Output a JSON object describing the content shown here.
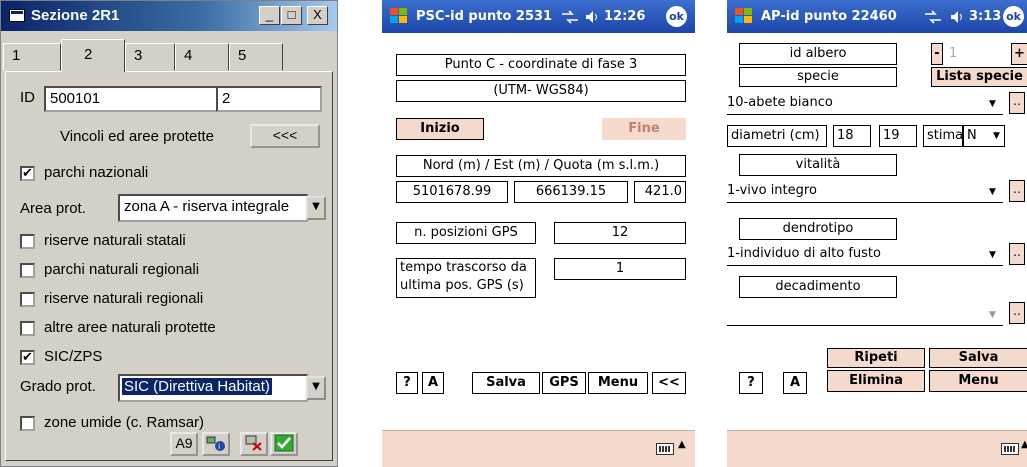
{
  "panel1": {
    "title": "Sezione 2R1",
    "window_buttons": [
      "_",
      "□",
      "X"
    ],
    "tabs": [
      "1",
      "2",
      "3",
      "4",
      "5"
    ],
    "active_tab": "2",
    "id_label": "ID",
    "id_value": "500101",
    "id_value2": "2",
    "vincoli_label": "Vincoli ed aree protette",
    "vincoli_button": "<<<",
    "parchi_nazionali": {
      "label": "parchi nazionali",
      "checked": true
    },
    "area_prot_label": "Area prot.",
    "area_prot_value": "zona A - riserva integrale",
    "checkboxes": [
      {
        "label": "riserve naturali statali",
        "checked": false
      },
      {
        "label": "parchi naturali regionali",
        "checked": false
      },
      {
        "label": "riserve naturali regionali",
        "checked": false
      },
      {
        "label": "altre aree naturali protette",
        "checked": false
      },
      {
        "label": "SIC/ZPS",
        "checked": true
      }
    ],
    "grado_label": "Grado prot.",
    "grado_value": "SIC (Direttiva Habitat)",
    "zone_umide": {
      "label": "zone umide (c. Ramsar)",
      "checked": false
    },
    "bottom_buttons": [
      "A9",
      "gps-info-icon",
      "gps-delete-icon",
      "confirm-check-icon"
    ]
  },
  "panel2": {
    "title": "PSC-id punto 2531",
    "status": "12:26",
    "ok": "ok",
    "heading1": "Punto C - coordinate di fase 3",
    "heading2": "(UTM- WGS84)",
    "inizio": "Inizio",
    "fine": "Fine",
    "coord_header": "Nord (m) / Est (m) / Quota (m s.l.m.)",
    "nord": "5101678.99",
    "est": "666139.15",
    "quota": "421.0",
    "posizioni_label": "n. posizioni GPS",
    "posizioni_value": "12",
    "tempo_label": "tempo trascorso da ultima pos. GPS (s)",
    "tempo_value": "1",
    "buttons": [
      "?",
      "A",
      "Salva",
      "GPS",
      "Menu",
      "<<"
    ]
  },
  "panel3": {
    "title": "AP-id punto 22460",
    "status": "3:13",
    "ok": "ok",
    "id_albero_label": "id albero",
    "minus": "-",
    "id_albero_value": "1",
    "plus": "+",
    "specie_label": "specie",
    "lista_specie": "Lista specie",
    "specie_value": "10-abete bianco",
    "diametri_label": "diametri (cm)",
    "diam1": "18",
    "diam2": "19",
    "stima_label": "stima",
    "stima_value": "N",
    "vitalita_label": "vitalità",
    "vitalita_value": "1-vivo integro",
    "dendrotipo_label": "dendrotipo",
    "dendrotipo_value": "1-individuo di alto fusto",
    "decadimento_label": "decadimento",
    "decadimento_value": "",
    "dots": "..",
    "buttons": {
      "help": "?",
      "a": "A",
      "ripeti": "Ripeti",
      "salva": "Salva",
      "elimina": "Elimina",
      "menu": "Menu"
    }
  },
  "colors": {
    "win_face": "#d4d0c8",
    "win_title": "#0a246a",
    "ppc_title": "#1c45a8",
    "ppc_footer": "#f4d9cd",
    "inizio_bg": "#f4d9cd",
    "fine_text": "#c08070",
    "selection": "#0a246a"
  }
}
